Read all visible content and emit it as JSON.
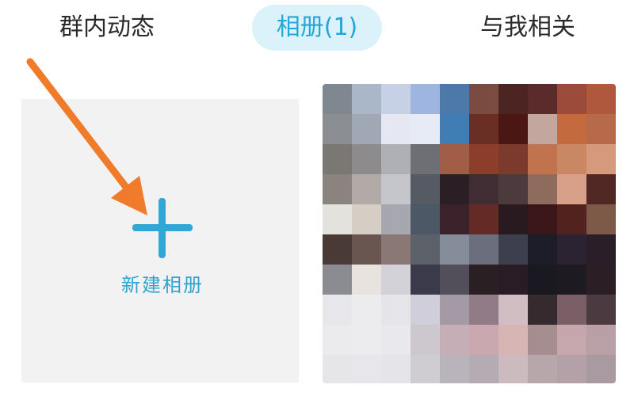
{
  "tabs": [
    {
      "label": "群内动态",
      "active": false
    },
    {
      "label": "相册(1)",
      "active": true
    },
    {
      "label": "与我相关",
      "active": false
    }
  ],
  "new_album": {
    "label": "新建相册",
    "icon": "plus-icon"
  },
  "album_thumbnail": {
    "description": "pixelated-photo",
    "palette": [
      [
        "#7f8790",
        "#a9b7c8",
        "#c6d1e6",
        "#9db5e0",
        "#4c79a8",
        "#7a4b40",
        "#4c2422",
        "#5a2b2a",
        "#9c4a3a",
        "#b0583e"
      ],
      [
        "#8a8e92",
        "#9fa8b4",
        "#e5e8f2",
        "#e7ebf6",
        "#3f7db4",
        "#6a2e24",
        "#4a1712",
        "#c3a79e",
        "#c46a3e",
        "#b76a4a"
      ],
      [
        "#7b7874",
        "#8d8b8b",
        "#aeb0b5",
        "#6d6f74",
        "#a25d46",
        "#8c3e2b",
        "#7b3a2c",
        "#c0734c",
        "#c98863",
        "#d59a7c"
      ],
      [
        "#8b837e",
        "#b2aaa6",
        "#c4c6cc",
        "#565a63",
        "#2b1e24",
        "#3f2d33",
        "#4d3a3d",
        "#8e6b5c",
        "#d8a088",
        "#502722"
      ],
      [
        "#e4e2dc",
        "#d6cdc4",
        "#a7a8af",
        "#4d5866",
        "#3b222a",
        "#642a26",
        "#281a1e",
        "#3b1619",
        "#52221e",
        "#7d5a48"
      ],
      [
        "#4a3a36",
        "#6a5651",
        "#8a7874",
        "#5c6068",
        "#858c9a",
        "#6b6f7d",
        "#3e3f4e",
        "#1d1d2a",
        "#2b2232",
        "#2a1f29"
      ],
      [
        "#8b8b92",
        "#e8e3de",
        "#d3d2d9",
        "#3a3a4a",
        "#524f5a",
        "#2a2024",
        "#291c24",
        "#1a1820",
        "#1d1a22",
        "#2c1e25"
      ],
      [
        "#e7e6ea",
        "#ecebee",
        "#e6e5ea",
        "#d0cedb",
        "#a39aa6",
        "#917b86",
        "#d1bec2",
        "#352b2e",
        "#7b5f66",
        "#4c3a41"
      ],
      [
        "#ebeaec",
        "#ecebed",
        "#e9e8ec",
        "#cdc7ce",
        "#c6aeb6",
        "#c9a8b0",
        "#d7b5b4",
        "#a68d90",
        "#c6a7ad",
        "#b9a0a7"
      ],
      [
        "#e6e5e8",
        "#e7e6ea",
        "#e5e4e8",
        "#cfccd2",
        "#b9b4bb",
        "#b5abb2",
        "#ccbbbe",
        "#b7a6aa",
        "#b3a1a7",
        "#a99aa1"
      ]
    ]
  },
  "annotation": {
    "arrow_color": "#f07b2a"
  }
}
